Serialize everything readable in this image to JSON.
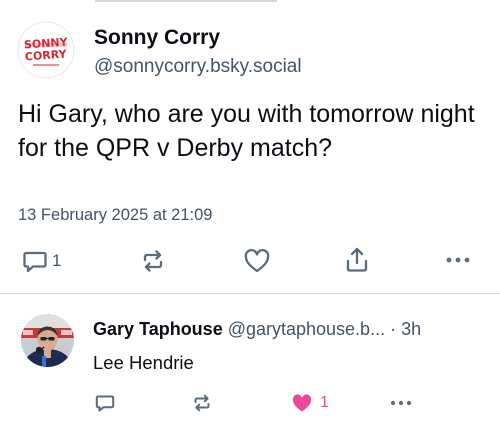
{
  "post": {
    "author": {
      "display_name": "Sonny Corry",
      "handle": "@sonnycorry.bsky.social",
      "avatar_logo_text": [
        "SONNY",
        "CORRY"
      ]
    },
    "text": "Hi Gary, who are you with tomorrow night for the QPR v Derby match?",
    "timestamp": "13 February 2025 at 21:09",
    "actions": {
      "reply_icon": "speech-bubble-icon",
      "reply_count": "1",
      "repost_icon": "repost-arrows-icon",
      "like_icon": "heart-outline-icon",
      "share_icon": "share-upload-icon",
      "more_icon": "ellipsis-icon"
    }
  },
  "reply": {
    "author": {
      "display_name": "Gary Taphouse",
      "handle": "@garytaphouse.b...",
      "time": "· 3h"
    },
    "text": "Lee Hendrie",
    "actions": {
      "reply_icon": "speech-bubble-icon",
      "repost_icon": "repost-arrows-icon",
      "like_icon": "heart-filled-icon",
      "like_count": "1",
      "more_icon": "ellipsis-icon"
    }
  },
  "colors": {
    "text_primary": "#0b0f14",
    "text_secondary": "#425466",
    "icon": "#5b6b7d",
    "liked": "#ec4899",
    "divider": "#d4d9e1",
    "logo_red": "#d8262e"
  }
}
